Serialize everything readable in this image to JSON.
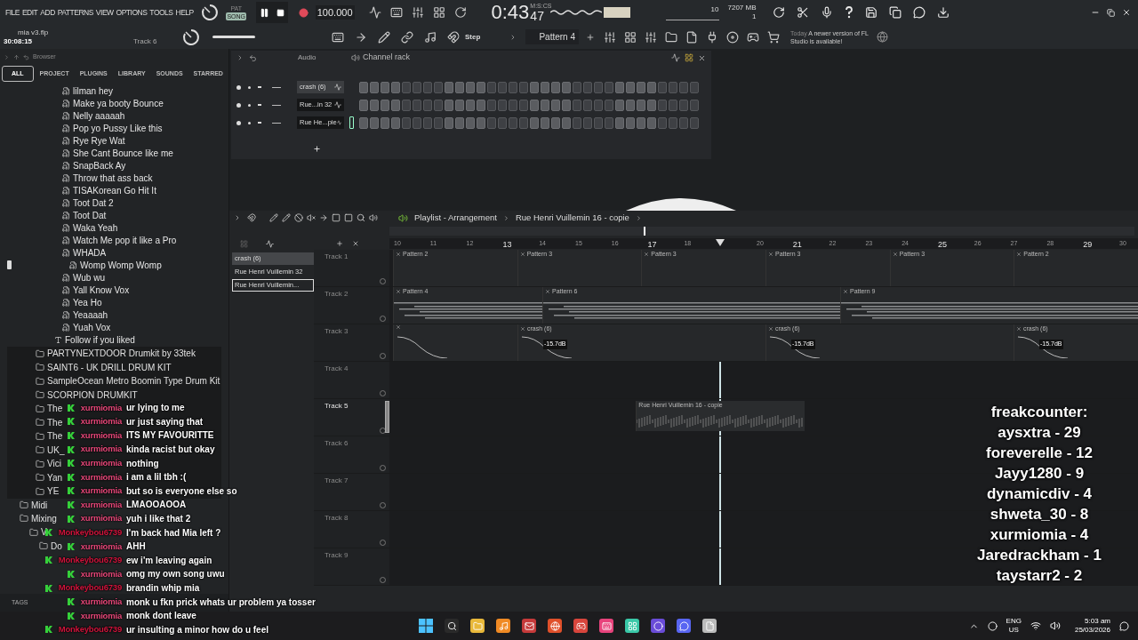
{
  "menu": [
    "FILE",
    "EDIT",
    "ADD",
    "PATTERNS",
    "VIEW",
    "OPTIONS",
    "TOOLS",
    "HELP"
  ],
  "transport": {
    "modes": [
      {
        "label": "PAT",
        "selected": false
      },
      {
        "label": "SONG",
        "selected": true
      }
    ],
    "tempo": "100.000",
    "time": "0:43",
    "time_sub": "47",
    "time_label": "M:S:CS",
    "cpu": "10",
    "memory": "7207 MB",
    "poly": "1"
  },
  "project": {
    "file": "mia v3.flp",
    "duration": "30:08:15",
    "track": "Track 6"
  },
  "snap": "Step",
  "pattern": "Pattern 4",
  "news": {
    "when": "Today",
    "text": "A newer version of FL Studio is available!"
  },
  "browser": {
    "title": "Browser",
    "tabs": [
      {
        "label": "ALL",
        "selected": true
      },
      {
        "label": "PROJECT",
        "selected": false
      },
      {
        "label": "PLUGINS",
        "selected": false
      },
      {
        "label": "LIBRARY",
        "selected": false
      },
      {
        "label": "SOUNDS",
        "selected": false
      },
      {
        "label": "STARRED",
        "selected": false
      }
    ],
    "files": [
      {
        "label": "lilman hey",
        "selected": false
      },
      {
        "label": "Make ya booty Bounce",
        "selected": false
      },
      {
        "label": "Nelly aaaaah",
        "selected": false
      },
      {
        "label": "Pop yo Pussy Like this",
        "selected": false
      },
      {
        "label": "Rye Rye Wat",
        "selected": false
      },
      {
        "label": "She Cant Bounce like me",
        "selected": false
      },
      {
        "label": "SnapBack Ay",
        "selected": false
      },
      {
        "label": "Throw that ass back",
        "selected": false
      },
      {
        "label": "TISAKorean Go Hit It",
        "selected": false
      },
      {
        "label": "Toot Dat 2",
        "selected": false
      },
      {
        "label": "Toot Dat",
        "selected": false
      },
      {
        "label": "Waka Yeah",
        "selected": false
      },
      {
        "label": "Watch Me pop it like a Pro",
        "selected": false
      },
      {
        "label": "WHADA",
        "selected": false
      },
      {
        "label": "Womp Womp Womp",
        "selected": true
      },
      {
        "label": "Wub wu",
        "selected": false
      },
      {
        "label": "Yall Know Vox",
        "selected": false
      },
      {
        "label": "Yea Ho",
        "selected": false
      },
      {
        "label": "Yeaaaah",
        "selected": false
      },
      {
        "label": "Yuah Vox",
        "selected": false
      }
    ],
    "note": "Follow if you liked",
    "kits": [
      "PARTYNEXTDOOR Drumkit by 33tek",
      "SAINT6 - UK DRILL DRUM KIT",
      "SampleOcean Metro Boomin Type Drum Kit",
      "SCORPION DRUMKIT",
      "The",
      "The",
      "The",
      "UK_",
      "Vici",
      "Yan",
      "YE"
    ],
    "folders": [
      {
        "label": "Midi"
      },
      {
        "label": "Mixing",
        "children": [
          {
            "label": "V",
            "children": [
              {
                "label": "Do"
              }
            ]
          }
        ]
      }
    ],
    "tags": "TAGS"
  },
  "channel_rack": {
    "menu": "Audio",
    "title": "Channel rack",
    "channels": [
      {
        "name": "crash (6)",
        "selected": true
      },
      {
        "name": "Rue...in 32",
        "selected": false
      },
      {
        "name": "Rue He...pie",
        "selected": false
      }
    ]
  },
  "playlist": {
    "title": "Playlist - Arrangement",
    "arrangement": "Rue Henri Vuillemin 16 - copie",
    "picker": [
      {
        "label": "crash (6)",
        "current": true,
        "selected": false
      },
      {
        "label": "Rue Henri Vuillemin 32",
        "current": false,
        "selected": false
      },
      {
        "label": "Rue Henri Vuillemin...",
        "current": false,
        "selected": true
      }
    ],
    "ruler": [
      {
        "kind": "bar",
        "label": "10",
        "major": false
      },
      {
        "kind": "bar",
        "label": "11",
        "major": false
      },
      {
        "kind": "bar",
        "label": "12",
        "major": false
      },
      {
        "kind": "bar",
        "label": "13",
        "major": true
      },
      {
        "kind": "bar",
        "label": "14",
        "major": false
      },
      {
        "kind": "bar",
        "label": "15",
        "major": false
      },
      {
        "kind": "bar",
        "label": "16",
        "major": false
      },
      {
        "kind": "bar",
        "label": "17",
        "major": true
      },
      {
        "kind": "bar",
        "label": "18",
        "major": false
      },
      {
        "kind": "playhead"
      },
      {
        "kind": "bar",
        "label": "20",
        "major": false
      },
      {
        "kind": "bar",
        "label": "21",
        "major": true
      },
      {
        "kind": "bar",
        "label": "22",
        "major": false
      },
      {
        "kind": "bar",
        "label": "23",
        "major": false
      },
      {
        "kind": "bar",
        "label": "24",
        "major": false
      },
      {
        "kind": "bar",
        "label": "25",
        "major": true
      },
      {
        "kind": "bar",
        "label": "26",
        "major": false
      },
      {
        "kind": "bar",
        "label": "27",
        "major": false
      },
      {
        "kind": "bar",
        "label": "28",
        "major": false
      },
      {
        "kind": "bar",
        "label": "29",
        "major": true
      },
      {
        "kind": "bar",
        "label": "30",
        "major": false
      }
    ],
    "tracks": [
      {
        "name": "Track 1",
        "selected": false,
        "clips": [
          {
            "kind": "pattern",
            "label": "Pattern 2"
          },
          {
            "kind": "pattern",
            "label": "Pattern 3"
          },
          {
            "kind": "pattern",
            "label": "Pattern 3"
          },
          {
            "kind": "pattern",
            "label": "Pattern 3"
          },
          {
            "kind": "pattern",
            "label": "Pattern 3"
          },
          {
            "kind": "pattern",
            "label": "Pattern 2"
          }
        ]
      },
      {
        "name": "Track 2",
        "selected": false,
        "clips": [
          {
            "kind": "notes",
            "label": "Pattern 4",
            "wide": false
          },
          {
            "kind": "notes",
            "label": "Pattern 6",
            "wide": true
          },
          {
            "kind": "notes",
            "label": "Pattern 9",
            "wide": true
          }
        ]
      },
      {
        "name": "Track 3",
        "selected": false,
        "clips": [
          {
            "kind": "fade",
            "wide": false
          },
          {
            "kind": "fade",
            "label": "crash (6)",
            "gain": "-15.7dB",
            "wide": true
          },
          {
            "kind": "fade",
            "label": "crash (6)",
            "gain": "-15.7dB",
            "wide": true
          },
          {
            "kind": "fade",
            "label": "crash (6)",
            "gain": "-15.7dB",
            "wide": false
          }
        ]
      },
      {
        "name": "Track 4",
        "selected": false
      },
      {
        "name": "Track 5",
        "selected": true,
        "clips": [
          {
            "kind": "audio",
            "label": "Rue Henri Vuillemin 16 - copie"
          }
        ]
      },
      {
        "name": "Track 6",
        "selected": false
      },
      {
        "name": "Track 7",
        "selected": false
      },
      {
        "name": "Track 8",
        "selected": false
      },
      {
        "name": "Track 9",
        "selected": false
      }
    ]
  },
  "chat": [
    {
      "user": "xurmiomia",
      "color": "#e8487a",
      "text": "ur lying to me"
    },
    {
      "user": "xurmiomia",
      "color": "#e8487a",
      "text": "ur just saying that"
    },
    {
      "user": "xurmiomia",
      "color": "#e8487a",
      "text": "ITS MY FAVOURITTE"
    },
    {
      "user": "xurmiomia",
      "color": "#e8487a",
      "text": "kinda racist but okay"
    },
    {
      "user": "xurmiomia",
      "color": "#e8487a",
      "text": "nothing"
    },
    {
      "user": "xurmiomia",
      "color": "#e8487a",
      "text": "i am a lil tbh :("
    },
    {
      "user": "xurmiomia",
      "color": "#e8487a",
      "text": "but so is everyone else so"
    },
    {
      "user": "xurmiomia",
      "color": "#e8487a",
      "text": "LMAOOAOOA"
    },
    {
      "user": "xurmiomia",
      "color": "#e8487a",
      "text": "yuh i like that 2"
    },
    {
      "user": "Monkeybou6739",
      "color": "#d0143c",
      "text": "I'm back had Mia left ?"
    },
    {
      "user": "xurmiomia",
      "color": "#e8487a",
      "text": "AHH"
    },
    {
      "user": "Monkeybou6739",
      "color": "#d0143c",
      "text": "ew i'm leaving again"
    },
    {
      "user": "xurmiomia",
      "color": "#e8487a",
      "text": "omg my own song uwu"
    },
    {
      "user": "Monkeybou6739",
      "color": "#d0143c",
      "text": "brandin whip mia"
    },
    {
      "user": "xurmiomia",
      "color": "#e8487a",
      "text": "monk u fkn prick whats ur problem ya tosser"
    },
    {
      "user": "xurmiomia",
      "color": "#e8487a",
      "text": "monk dont leave"
    },
    {
      "user": "Monkeybou6739",
      "color": "#d0143c",
      "text": "ur insulting a minor how do u feel"
    }
  ],
  "counter": {
    "title": "freakcounter:",
    "entries": [
      "aysxtra - 29",
      "foreverelle - 12",
      "Jayy1280 - 9",
      "dynamicdiv - 4",
      "shweta_30 - 8",
      "xurmiomia - 4",
      "Jaredrackham - 1",
      "taystarr2 - 2"
    ]
  },
  "taskbar": {
    "language": "ENG",
    "region": "US",
    "time": "5:03 am",
    "date": "25/03/2026"
  }
}
